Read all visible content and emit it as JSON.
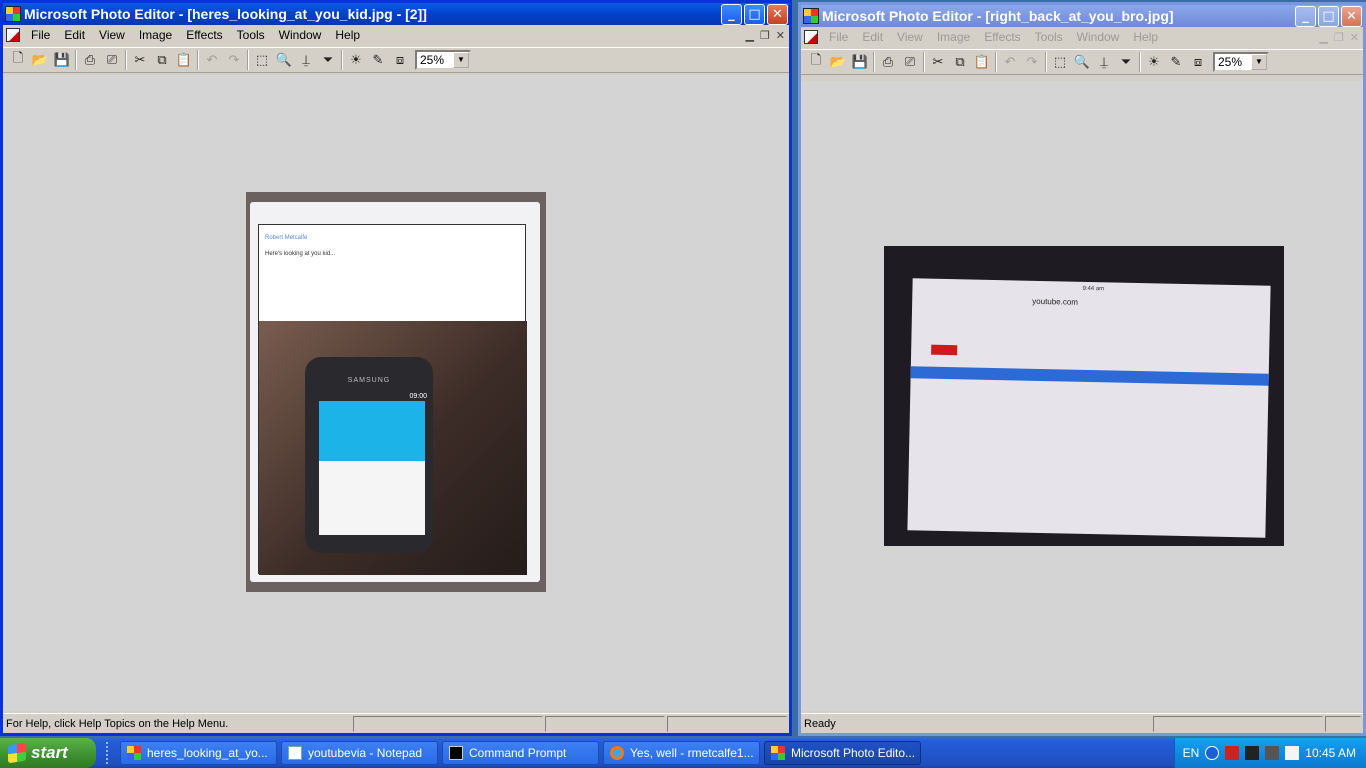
{
  "left_window": {
    "title": "Microsoft Photo Editor - [heres_looking_at_you_kid.jpg - [2]]",
    "menu": [
      "File",
      "Edit",
      "View",
      "Image",
      "Effects",
      "Tools",
      "Window",
      "Help"
    ],
    "zoom": "25%",
    "status": "For Help, click Help Topics on the Help Menu.",
    "photo": {
      "mail_sender": "Robert Metcalfe",
      "mail_subject": "Here's looking at you kid...",
      "phone_brand": "SAMSUNG",
      "phone_clock": "09:00"
    }
  },
  "right_window": {
    "title": "Microsoft Photo Editor - [right_back_at_you_bro.jpg]",
    "menu": [
      "File",
      "Edit",
      "View",
      "Image",
      "Effects",
      "Tools",
      "Window",
      "Help"
    ],
    "zoom": "25%",
    "status": "Ready",
    "photo": {
      "url": "youtube.com",
      "time": "9:44 am",
      "logo": "YouTube"
    }
  },
  "taskbar": {
    "start_label": "start",
    "tasks": [
      {
        "label": "heres_looking_at_yo...",
        "icon": "photo-editor-icon",
        "active": false
      },
      {
        "label": "youtubevia - Notepad",
        "icon": "notepad-icon",
        "active": false
      },
      {
        "label": "Command Prompt",
        "icon": "cmd-icon",
        "active": false
      },
      {
        "label": "Yes, well - rmetcalfe1...",
        "icon": "firefox-icon",
        "active": false
      },
      {
        "label": "Microsoft Photo Edito...",
        "icon": "photo-editor-icon",
        "active": true
      }
    ],
    "language": "EN",
    "clock": "10:45 AM"
  },
  "colors": {
    "titlebar_active": "#0a5de8",
    "titlebar_inactive": "#7d98e0",
    "taskbar": "#245ddb",
    "start_button": "#3c8f2e",
    "tray": "#0f8be1"
  }
}
